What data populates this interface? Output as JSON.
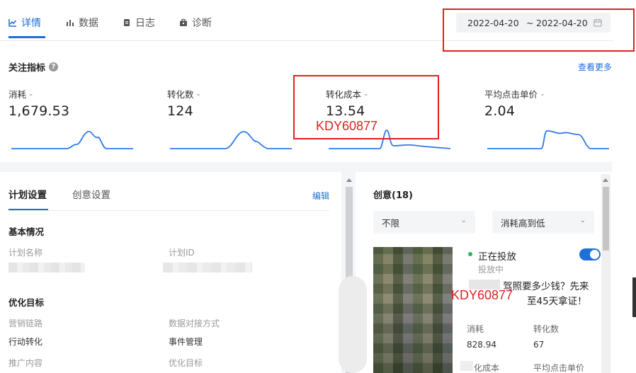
{
  "tabs": [
    {
      "label": "详情",
      "icon": "chart-line-icon",
      "active": true
    },
    {
      "label": "数据",
      "icon": "bar-chart-icon",
      "active": false
    },
    {
      "label": "日志",
      "icon": "document-icon",
      "active": false
    },
    {
      "label": "诊断",
      "icon": "briefcase-icon",
      "active": false
    }
  ],
  "date_range": {
    "start": "2022-04-20",
    "separator": "~",
    "end": "2022-04-20",
    "icon": "calendar-icon"
  },
  "focus_metrics": {
    "title": "关注指标",
    "see_more": "查看更多",
    "items": [
      {
        "label": "消耗",
        "value": "1,679.53"
      },
      {
        "label": "转化数",
        "value": "124"
      },
      {
        "label": "转化成本",
        "value": "13.54"
      },
      {
        "label": "平均点击单价",
        "value": "2.04"
      }
    ]
  },
  "watermark": "KDY60877",
  "plan": {
    "subtabs": [
      "计划设置",
      "创意设置"
    ],
    "edit": "编辑",
    "basic_title": "基本情况",
    "plan_name_label": "计划名称",
    "plan_id_label": "计划ID",
    "optimize_title": "优化目标",
    "marketing_chain_label": "营销链路",
    "marketing_chain_value": "行动转化",
    "data_method_label": "数据对接方式",
    "data_method_value": "事件管理",
    "promote_label": "推广内容",
    "optimize_goal_label": "优化目标"
  },
  "creative": {
    "title": "创意(18)",
    "filter_all": "不限",
    "sort": "消耗高到低",
    "status": "正在投放",
    "sub_status": "投放中",
    "headline_1": "驾照要多少钱？先来",
    "headline_2": "至45天拿证！",
    "stat_cost_label": "消耗",
    "stat_cost_value": "828.94",
    "stat_conv_label": "转化数",
    "stat_conv_value": "67",
    "stat_cpa_label": "化成本",
    "stat_cpc_label": "平均点击单价"
  },
  "colors": {
    "accent": "#1f6fd8",
    "annotation_red": "#e02020"
  }
}
